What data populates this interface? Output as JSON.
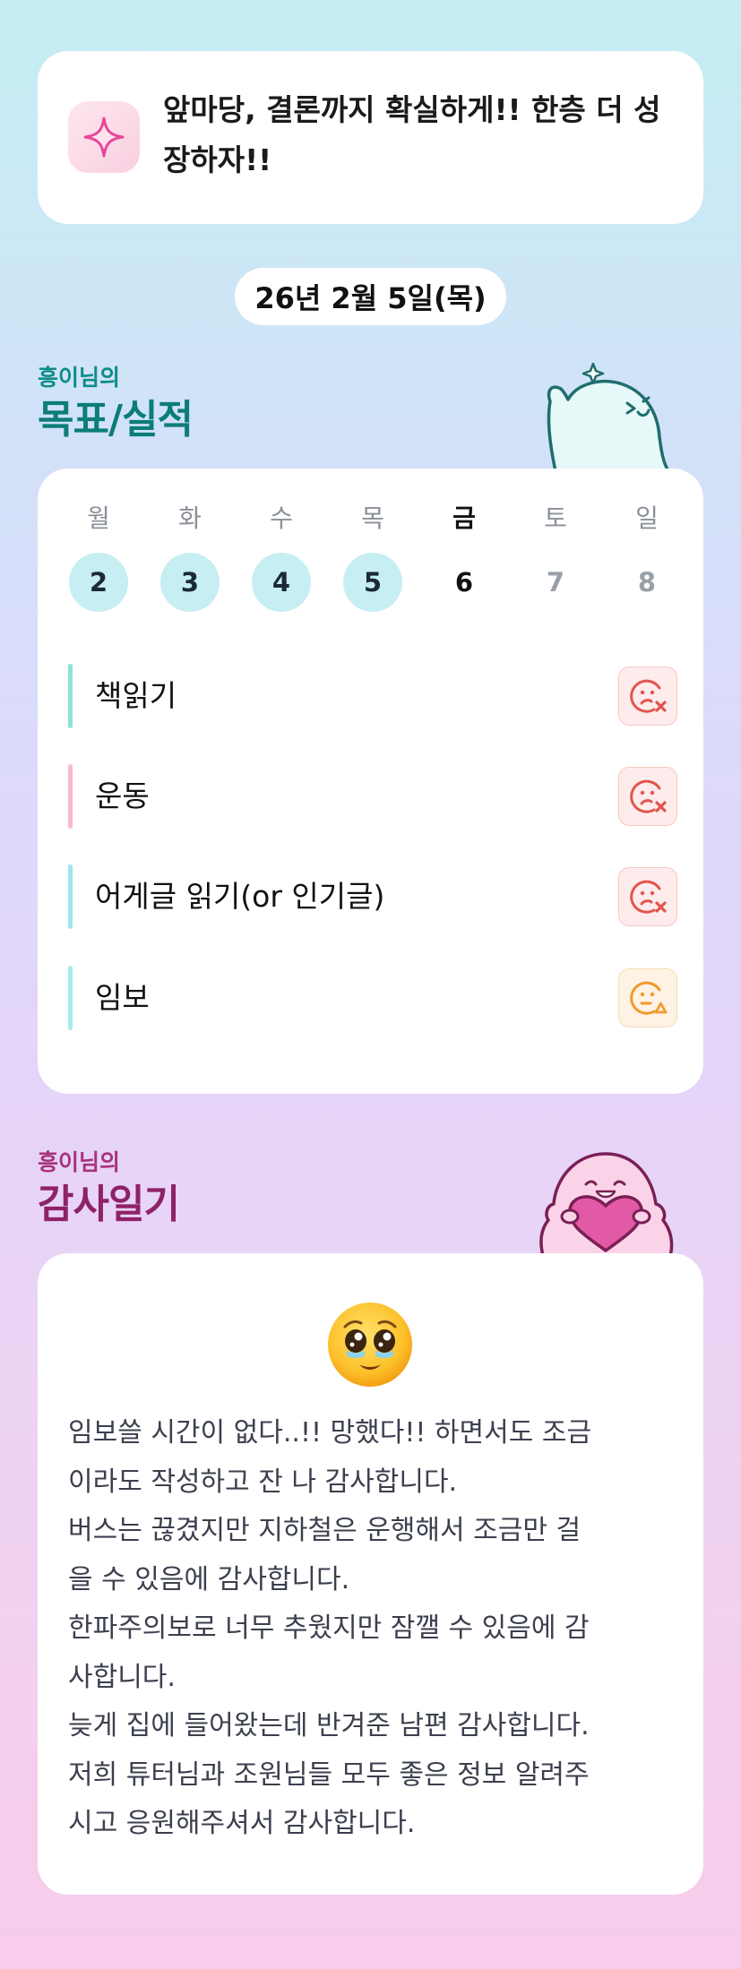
{
  "motto": {
    "icon": "sparkle-icon",
    "text": "앞마당, 결론까지 확실하게!! 한층 더 성장하자!!"
  },
  "date": "26년 2월 5일(목)",
  "goals_section": {
    "subtitle": "흥이님의",
    "title": "목표/실적",
    "mascot": "waving-ghost-mascot"
  },
  "week": [
    {
      "day": "월",
      "date": "2",
      "state": "done"
    },
    {
      "day": "화",
      "date": "3",
      "state": "done"
    },
    {
      "day": "수",
      "date": "4",
      "state": "done"
    },
    {
      "day": "목",
      "date": "5",
      "state": "done"
    },
    {
      "day": "금",
      "date": "6",
      "state": "today"
    },
    {
      "day": "토",
      "date": "7",
      "state": "future"
    },
    {
      "day": "일",
      "date": "8",
      "state": "future"
    }
  ],
  "goals": [
    {
      "label": "책읽기",
      "bar_color": "#8ee3d6",
      "status": "fail",
      "status_icon": "sad-face-x-icon"
    },
    {
      "label": "운동",
      "bar_color": "#f7b9d4",
      "status": "fail",
      "status_icon": "sad-face-x-icon"
    },
    {
      "label": "어게글 읽기(or 인기글)",
      "bar_color": "#9fe6ee",
      "status": "fail",
      "status_icon": "sad-face-x-icon"
    },
    {
      "label": "임보",
      "bar_color": "#a6ecee",
      "status": "partial",
      "status_icon": "neutral-face-triangle-icon"
    }
  ],
  "diary_section": {
    "subtitle": "흥이님의",
    "title": "감사일기",
    "mascot": "heart-hugging-ghost-mascot"
  },
  "diary": {
    "emoji": "pleading-face-emoji",
    "text": "임보쓸 시간이 없다..!! 망했다!! 하면서도 조금\n이라도 작성하고 잔 나 감사합니다.\n버스는 끊겼지만 지하철은 운행해서 조금만 걸\n을 수 있음에 감사합니다.\n한파주의보로 너무 추웠지만 잠깰 수 있음에 감\n사합니다.\n늦게 집에 들어왔는데 반겨준 남편 감사합니다.\n저희 튜터님과 조원님들 모두 좋은 정보 알려주\n시고 응원해주셔서 감사합니다."
  },
  "colors": {
    "teal_title": "#0c7d79",
    "plum_title": "#8e2267",
    "done_circle": "#c6eef3",
    "fail_icon": "#e2554f",
    "partial_icon": "#f09a2c"
  }
}
